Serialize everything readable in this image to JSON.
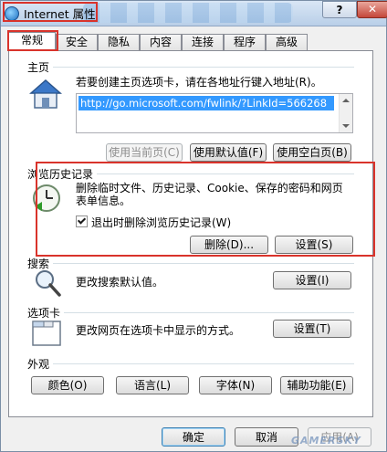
{
  "window": {
    "title": "Internet 属性",
    "help_label": "?",
    "close_label": "✕"
  },
  "tabs": [
    {
      "label": "常规",
      "active": true
    },
    {
      "label": "安全"
    },
    {
      "label": "隐私"
    },
    {
      "label": "内容"
    },
    {
      "label": "连接"
    },
    {
      "label": "程序"
    },
    {
      "label": "高级"
    }
  ],
  "homepage": {
    "group_label": "主页",
    "instruction": "若要创建主页选项卡，请在各地址行键入地址(R)。",
    "url_value": "http://go.microsoft.com/fwlink/?LinkId=566268",
    "use_current_label": "使用当前页(C)",
    "use_default_label": "使用默认值(F)",
    "use_blank_label": "使用空白页(B)"
  },
  "history": {
    "group_label": "浏览历史记录",
    "description_line1": "删除临时文件、历史记录、Cookie、保存的密码和网页",
    "description_line2": "表单信息。",
    "checkbox_label": "退出时删除浏览历史记录(W)",
    "checkbox_checked": true,
    "delete_label": "删除(D)...",
    "settings_label": "设置(S)"
  },
  "search": {
    "group_label": "搜索",
    "description": "更改搜索默认值。",
    "settings_label": "设置(I)"
  },
  "tabs_section": {
    "group_label": "选项卡",
    "description": "更改网页在选项卡中显示的方式。",
    "settings_label": "设置(T)"
  },
  "appearance": {
    "group_label": "外观",
    "colors_label": "颜色(O)",
    "languages_label": "语言(L)",
    "fonts_label": "字体(N)",
    "accessibility_label": "辅助功能(E)"
  },
  "footer": {
    "ok_label": "确定",
    "cancel_label": "取消",
    "apply_label": "应用(A)",
    "watermark": "GAMERSKY"
  },
  "colors": {
    "highlight": "#d9332b",
    "selection": "#3399ff"
  }
}
